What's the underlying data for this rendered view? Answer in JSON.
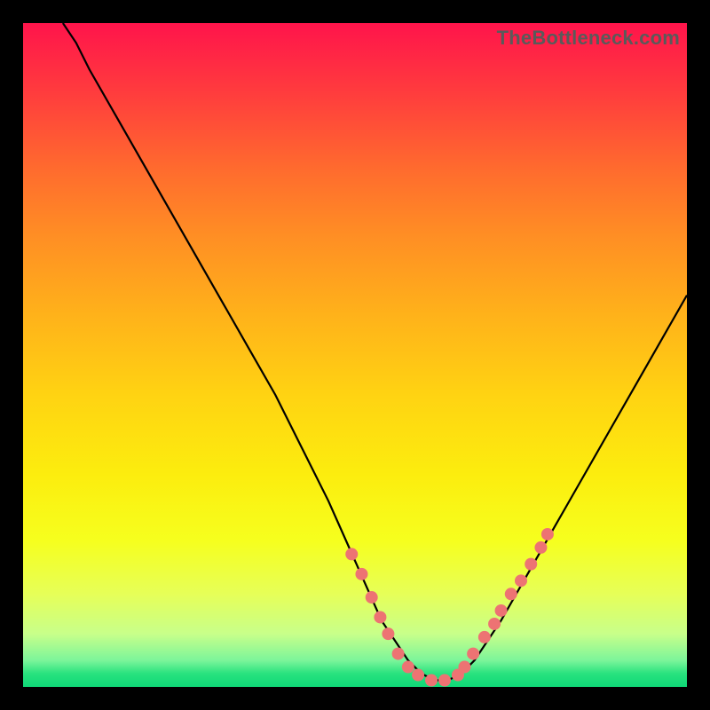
{
  "watermark": "TheBottleneck.com",
  "chart_data": {
    "type": "line",
    "title": "",
    "xlabel": "",
    "ylabel": "",
    "xlim": [
      0,
      100
    ],
    "ylim": [
      0,
      100
    ],
    "grid": false,
    "legend": false,
    "series": [
      {
        "name": "curve",
        "color": "#000000",
        "x": [
          6,
          8,
          10,
          14,
          18,
          22,
          26,
          30,
          34,
          38,
          42,
          46,
          50,
          54,
          56,
          58,
          60,
          62,
          64,
          66,
          68,
          70,
          72,
          76,
          80,
          84,
          88,
          92,
          96,
          100
        ],
        "y": [
          100,
          97,
          93,
          86,
          79,
          72,
          65,
          58,
          51,
          44,
          36,
          28,
          19,
          10,
          7,
          4,
          2,
          1,
          1,
          2,
          4,
          7,
          10,
          17,
          24,
          31,
          38,
          45,
          52,
          59
        ]
      }
    ],
    "markers": {
      "name": "highlighted-points",
      "color": "#ed7373",
      "radius": 7,
      "x": [
        49.5,
        51.0,
        52.5,
        53.8,
        55.0,
        56.5,
        58.0,
        59.5,
        61.5,
        63.5,
        65.5,
        66.5,
        67.8,
        69.5,
        71.0,
        72.0,
        73.5,
        75.0,
        76.5,
        78.0,
        79.0
      ],
      "y": [
        20.0,
        17.0,
        13.5,
        10.5,
        8.0,
        5.0,
        3.0,
        1.8,
        1.0,
        1.0,
        1.8,
        3.0,
        5.0,
        7.5,
        9.5,
        11.5,
        14.0,
        16.0,
        18.5,
        21.0,
        23.0
      ]
    }
  }
}
